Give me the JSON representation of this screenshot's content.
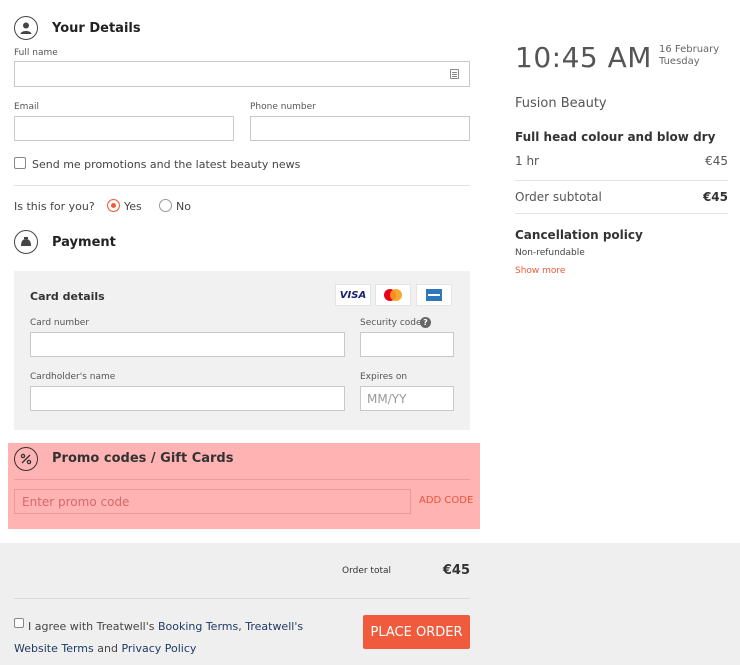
{
  "details": {
    "title": "Your Details",
    "full_name_label": "Full name",
    "email_label": "Email",
    "phone_label": "Phone number",
    "promo_checkbox_label": "Send me promotions and the latest beauty news",
    "for_you_question": "Is this for you?",
    "yes_label": "Yes",
    "no_label": "No",
    "for_you_selected": "Yes"
  },
  "payment": {
    "title": "Payment",
    "card_details_title": "Card details",
    "card_number_label": "Card number",
    "security_code_label": "Security code",
    "security_help_icon": "?",
    "cardholder_label": "Cardholder's name",
    "expires_label": "Expires on",
    "expires_placeholder": "MM/YY",
    "logos": {
      "visa": "VISA"
    }
  },
  "promo": {
    "title": "Promo codes / Gift Cards",
    "input_placeholder": "Enter promo code",
    "add_code_label": "ADD CODE"
  },
  "summary": {
    "time": "10:45 AM",
    "date": "16 February",
    "weekday": "Tuesday",
    "venue": "Fusion Beauty",
    "service_name": "Full head colour and blow dry",
    "duration": "1 hr",
    "service_price": "€45",
    "subtotal_label": "Order subtotal",
    "subtotal_value": "€45",
    "cancellation_title": "Cancellation policy",
    "cancellation_text": "Non-refundable",
    "show_more": "Show more"
  },
  "footer": {
    "order_total_label": "Order total",
    "order_total_value": "€45",
    "agree_prefix": "I agree with Treatwell's ",
    "booking_terms": "Booking Terms",
    "comma": ", ",
    "treatwell_word": "Treatwell's",
    "website_terms": "Website Terms",
    "and_word": " and ",
    "privacy_policy": "Privacy Policy",
    "place_order_label": "PLACE ORDER"
  },
  "colors": {
    "accent": "#ef5b3c",
    "promo_highlight": "#ffb3b3",
    "link": "#1f3a64"
  }
}
